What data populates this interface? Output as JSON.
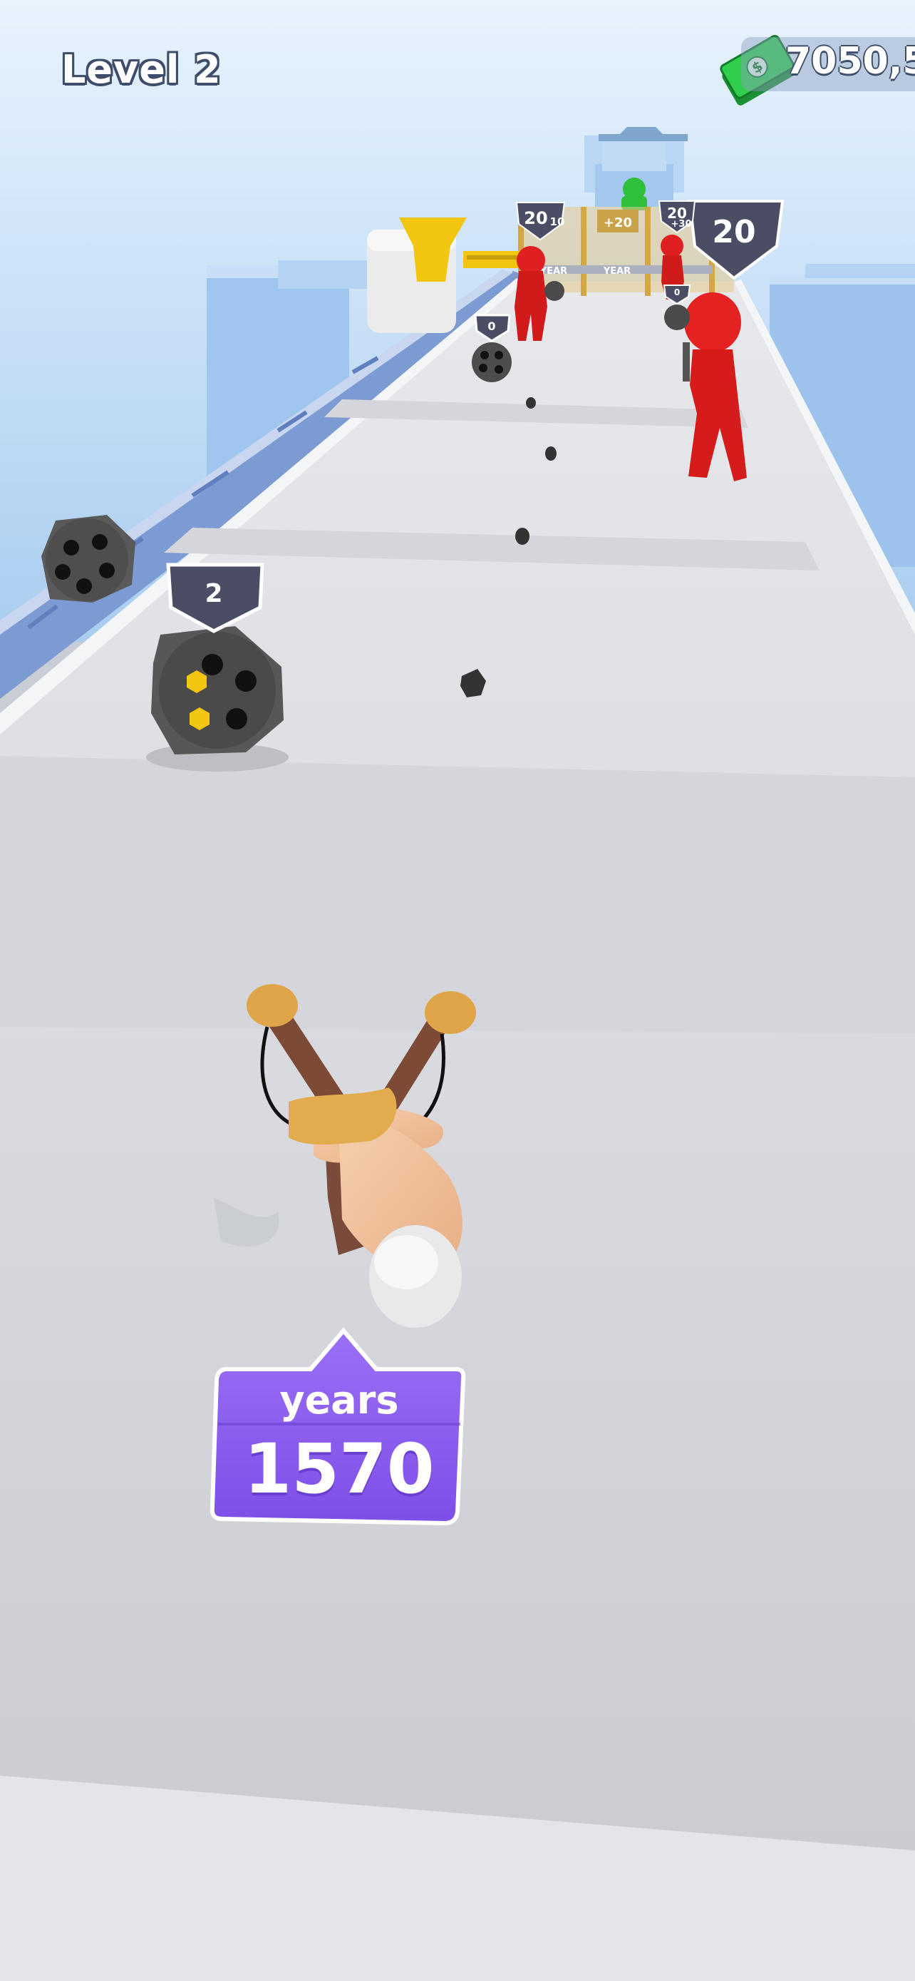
{
  "hud": {
    "level_label": "Level 2",
    "cash_amount": "7050,5",
    "cash_icon": "cash-bill-icon"
  },
  "player": {
    "weapon": "slingshot",
    "years_label": "years",
    "years_value": "1570"
  },
  "track_items": {
    "near_revolver_count": "2",
    "mid_revolver_count": "0",
    "far_revolver_count": "0",
    "enemy_big_badge": "20",
    "enemy_far_badge": "20",
    "enemy_far_badge_sub": "10",
    "enemy_right_far_badge": "20",
    "enemy_right_far_badge_sub": "+30"
  },
  "gates": {
    "plus_value": "+20",
    "year_label_1": "YEAR",
    "year_label_2": "YEAR"
  },
  "colors": {
    "sky_top": "#d9ecfb",
    "sky_bottom": "#9cc4ec",
    "track": "#dfe1e6",
    "enemy": "#e02020",
    "boss": "#2fbf3a",
    "years_panel": "#8a5cf0",
    "badge": "#4a4d63"
  }
}
